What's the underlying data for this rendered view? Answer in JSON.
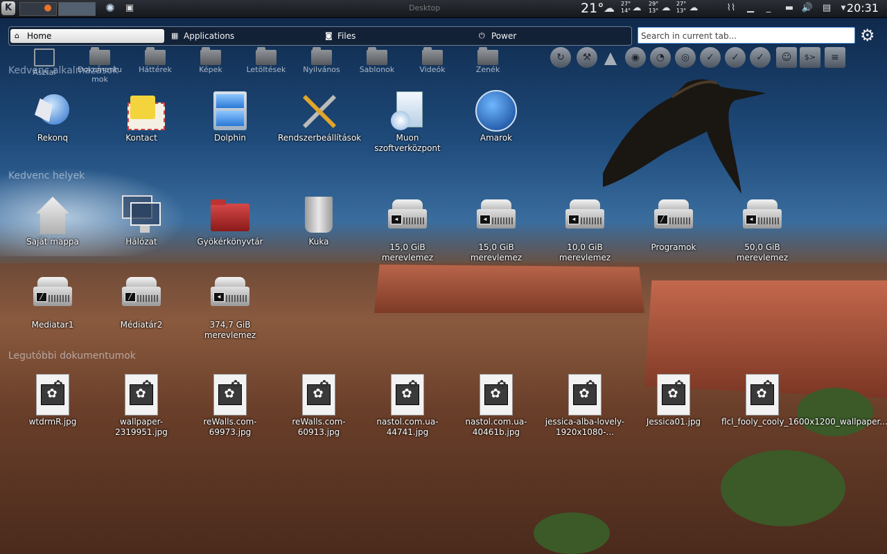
{
  "panel": {
    "window_title": "Desktop",
    "temperature": "21°",
    "forecast": [
      {
        "high": "27°",
        "low": "14°",
        "icon": "snow-cloud-icon"
      },
      {
        "high": "29°",
        "low": "13°",
        "icon": "snow-cloud-icon"
      },
      {
        "high": "27°",
        "low": "13°",
        "icon": "snow-cloud-icon"
      }
    ],
    "clock": "20:31"
  },
  "tabs": [
    {
      "label": "Home",
      "icon": "home-icon"
    },
    {
      "label": "Applications",
      "icon": "applications-icon"
    },
    {
      "label": "Files",
      "icon": "camera-icon"
    },
    {
      "label": "Power",
      "icon": "power-icon"
    }
  ],
  "search": {
    "placeholder": "Search in current tab..."
  },
  "places_bar": [
    {
      "label": "Asztal"
    },
    {
      "label": "Dokumentu mok"
    },
    {
      "label": "Háttérek"
    },
    {
      "label": "Képek"
    },
    {
      "label": "Letöltések"
    },
    {
      "label": "Nyilvános"
    },
    {
      "label": "Sablonok"
    },
    {
      "label": "Videók"
    },
    {
      "label": "Zenék"
    }
  ],
  "sections": {
    "favorite_apps": "Kedvenc alkalmazások",
    "favorite_places": "Kedvenc helyek",
    "recent_docs": "Legutóbbi dokumentumok"
  },
  "apps": [
    {
      "label": "Rekonq",
      "icon": "rekonq-icon"
    },
    {
      "label": "Kontact",
      "icon": "kontact-icon"
    },
    {
      "label": "Dolphin",
      "icon": "dolphin-icon"
    },
    {
      "label": "Rendszerbeállítások",
      "icon": "system-settings-icon"
    },
    {
      "label": "Muon szoftverközpont",
      "icon": "muon-icon"
    },
    {
      "label": "Amarok",
      "icon": "amarok-icon"
    }
  ],
  "places": [
    {
      "label": "Saját mappa"
    },
    {
      "label": "Hálózat"
    },
    {
      "label": "Gyökérkönyvtár"
    },
    {
      "label": "Kuka"
    },
    {
      "label": "15,0 GiB merevlemez"
    },
    {
      "label": "15,0 GiB merevlemez"
    },
    {
      "label": "10,0 GiB merevlemez"
    },
    {
      "label": "Programok"
    },
    {
      "label": "50,0 GiB merevlemez"
    },
    {
      "label": "Mediatar1"
    },
    {
      "label": "Médiatár2"
    },
    {
      "label": "374,7 GiB merevlemez"
    }
  ],
  "recent": [
    {
      "label": "wtdrmR.jpg"
    },
    {
      "label": "wallpaper-2319951.jpg"
    },
    {
      "label": "reWalls.com-69973.jpg"
    },
    {
      "label": "reWalls.com-60913.jpg"
    },
    {
      "label": "nastol.com.ua-44741.jpg"
    },
    {
      "label": "nastol.com.ua-40461b.jpg"
    },
    {
      "label": "jessica-alba-lovely-1920x1080-..."
    },
    {
      "label": "Jessica01.jpg"
    },
    {
      "label": "flcl_fooly_cooly_1600x1200_wallpaper..."
    }
  ]
}
